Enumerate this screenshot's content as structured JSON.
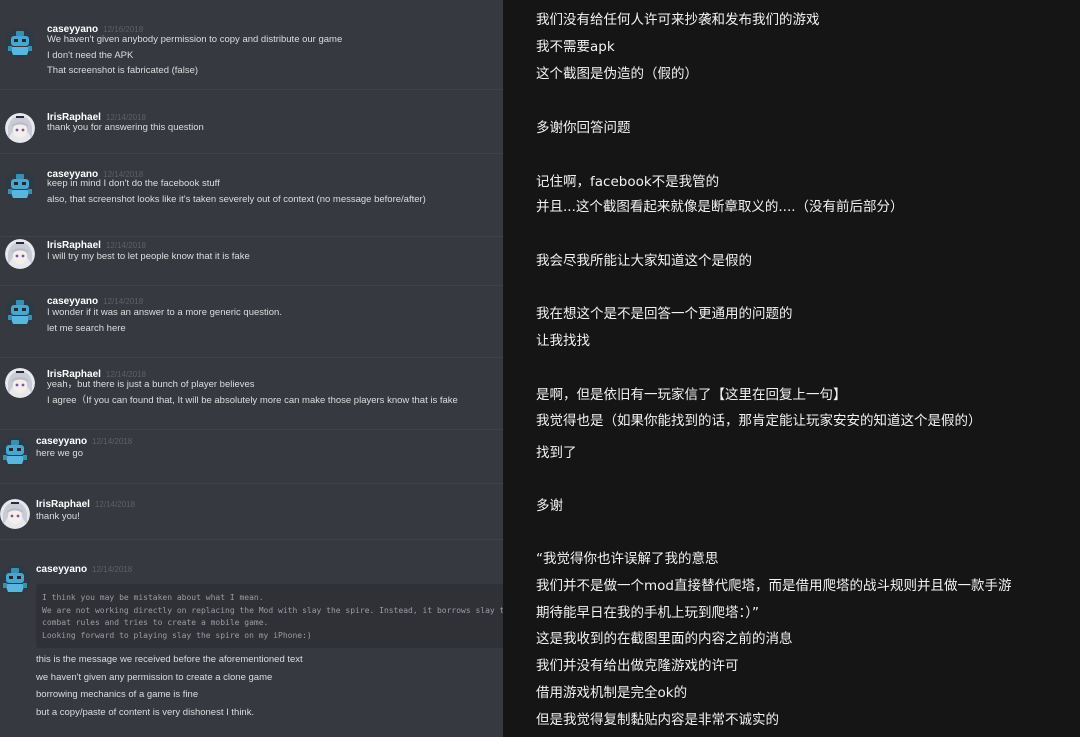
{
  "left_panel": {
    "messages": [
      {
        "user": "caseyyano",
        "timestamp": "12/16/2018",
        "avatar": "robot-avatar",
        "lines": [
          "We haven't given anybody permission to copy and distribute our game",
          "I don't need the APK",
          "That screenshot is fabricated (false)"
        ]
      },
      {
        "user": "IrisRaphael",
        "timestamp": "12/14/2018",
        "avatar": "anime-avatar",
        "lines": [
          "thank you for answering this question"
        ]
      },
      {
        "user": "caseyyano",
        "timestamp": "12/14/2018",
        "avatar": "robot-avatar",
        "lines": [
          "keep in mind I don't do the facebook stuff",
          "also, that screenshot looks like it's taken severely out of context (no message before/after)"
        ]
      },
      {
        "user": "IrisRaphael",
        "timestamp": "12/14/2018",
        "avatar": "anime-avatar",
        "lines": [
          "I will try my best to let people know that it is fake"
        ]
      },
      {
        "user": "caseyyano",
        "timestamp": "12/14/2018",
        "avatar": "robot-avatar",
        "lines": [
          "I wonder if it was an answer to a more generic question.",
          "let me search here"
        ]
      },
      {
        "user": "IrisRaphael",
        "timestamp": "12/14/2018",
        "avatar": "anime-avatar",
        "lines": [
          "yeah，but there is just a bunch of player believes",
          "I agree（If you can found that, It will be absolutely more can make those players know that is fake"
        ]
      },
      {
        "user": "caseyyano",
        "timestamp": "12/14/2018",
        "avatar": "robot-avatar",
        "lines": [
          "here we go"
        ]
      },
      {
        "user": "IrisRaphael",
        "timestamp": "12/14/2018",
        "avatar": "anime-avatar",
        "lines": [
          "thank you!"
        ]
      },
      {
        "user": "caseyyano",
        "timestamp": "12/14/2018",
        "avatar": "robot-avatar",
        "lines": []
      }
    ],
    "code_block": [
      "I think you may be mistaken about what I mean.",
      "We are not working directly on replacing the Mod with slay the spire. Instead, it borrows slay the spire's",
      "combat rules and tries to create a mobile game.",
      "Looking forward to playing slay the spire on my iPhone:)"
    ],
    "after_code": [
      "this is the message we received before the aforementioned text",
      "we haven't given any permission to create a clone game",
      "borrowing mechanics of a game is fine",
      "but a copy/paste of content is very dishonest I think."
    ]
  },
  "right_panel": {
    "lines": [
      "我们没有给任何人许可来抄袭和发布我们的游戏",
      "我不需要apk",
      "这个截图是伪造的（假的）",
      "多谢你回答问题",
      "记住啊，facebook不是我管的",
      "并且...这个截图看起来就像是断章取义的....（没有前后部分）",
      "我会尽我所能让大家知道这个是假的",
      "我在想这个是不是回答一个更通用的问题的",
      "让我找找",
      "是啊，但是依旧有一玩家信了【这里在回复上一句】",
      "我觉得也是（如果你能找到的话，那肯定能让玩家安安的知道这个是假的）",
      "找到了",
      "多谢",
      "“我觉得你也许误解了我的意思",
      "我们并不是做一个mod直接替代爬塔，而是借用爬塔的战斗规则并且做一款手游",
      "期待能早日在我的手机上玩到爬塔：）”",
      "这是我收到的在截图里面的内容之前的消息",
      "我们并没有给出做克隆游戏的许可",
      "借用游戏机制是完全ok的",
      "但是我觉得复制黏贴内容是非常不诚实的"
    ]
  },
  "colors": {
    "left_bg": "#36393f",
    "right_bg": "#151515",
    "username": "#ffffff",
    "timestamp": "#5d6067",
    "text": "#dcddde",
    "code_bg": "#2f3136"
  }
}
